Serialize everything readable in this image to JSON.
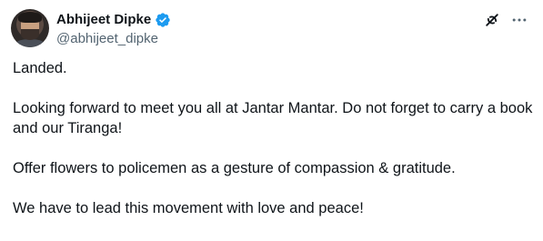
{
  "author": {
    "display_name": "Abhijeet Dipke",
    "handle": "@abhijeet_dipke",
    "verified": true,
    "verified_color": "#1d9bf0"
  },
  "icons": {
    "grok": "grok-icon",
    "more": "more-horizontal-icon"
  },
  "tweet": {
    "paragraphs": [
      "Landed.",
      "Looking forward to meet you all at Jantar Mantar. Do not forget to carry a book and our Tiranga!",
      "Offer flowers to policemen as a gesture of compassion & gratitude.",
      "We have to lead this movement with love and peace!"
    ]
  }
}
